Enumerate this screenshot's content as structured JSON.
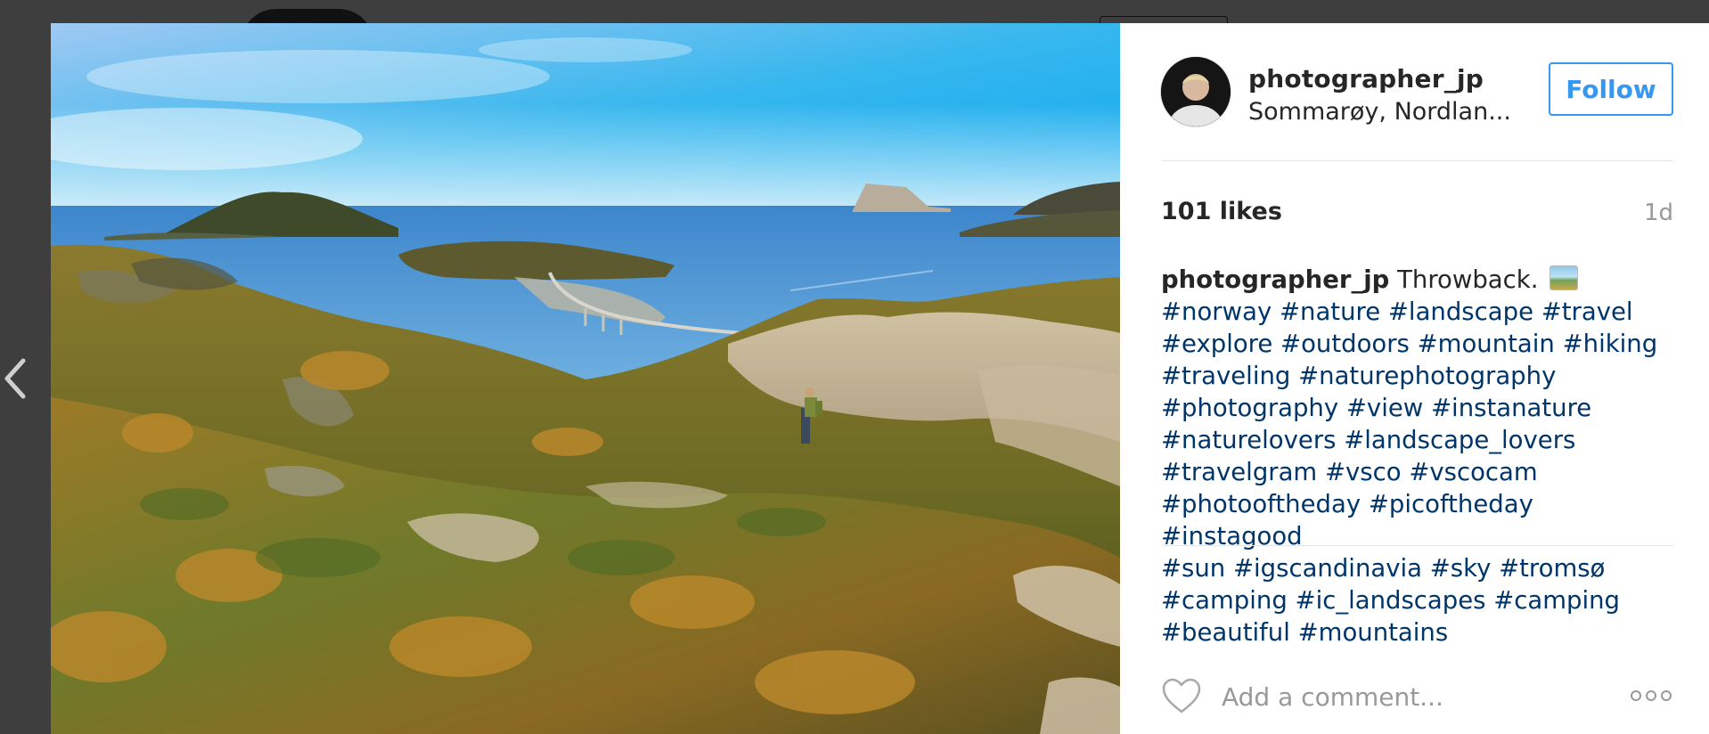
{
  "post": {
    "username": "photographer_jp",
    "location": "Sommarøy, Nordlan...",
    "follow_label": "Follow",
    "likes": "101 likes",
    "time_ago": "1d",
    "caption_user": "photographer_jp",
    "caption_text": "Throwback.",
    "caption_emoji": "landscape-photo-emoji",
    "hashtags": [
      [
        "#norway",
        "#nature",
        "#landscape",
        "#travel"
      ],
      [
        "#explore",
        "#outdoors",
        "#mountain",
        "#hiking"
      ],
      [
        "#traveling",
        "#naturephotography"
      ],
      [
        "#photography",
        "#view",
        "#instanature"
      ],
      [
        "#naturelovers",
        "#landscape_lovers"
      ],
      [
        "#travelgram",
        "#vsco",
        "#vscocam"
      ],
      [
        "#photooftheday",
        "#picoftheday",
        "#instagood"
      ],
      [
        "#sun",
        "#igscandinavia",
        "#sky",
        "#tromsø"
      ],
      [
        "#camping",
        "#ic_landscapes",
        "#camping"
      ],
      [
        "#beautiful",
        "#mountains"
      ]
    ],
    "comment_placeholder": "Add a comment..."
  },
  "nav": {
    "prev_icon": "chevron-left-icon"
  },
  "icons": {
    "like": "heart-outline-icon",
    "more": "more-options-icon"
  },
  "colors": {
    "link_blue": "#3897f0",
    "hashtag": "#003569",
    "overlay": "#3e3e3e"
  }
}
